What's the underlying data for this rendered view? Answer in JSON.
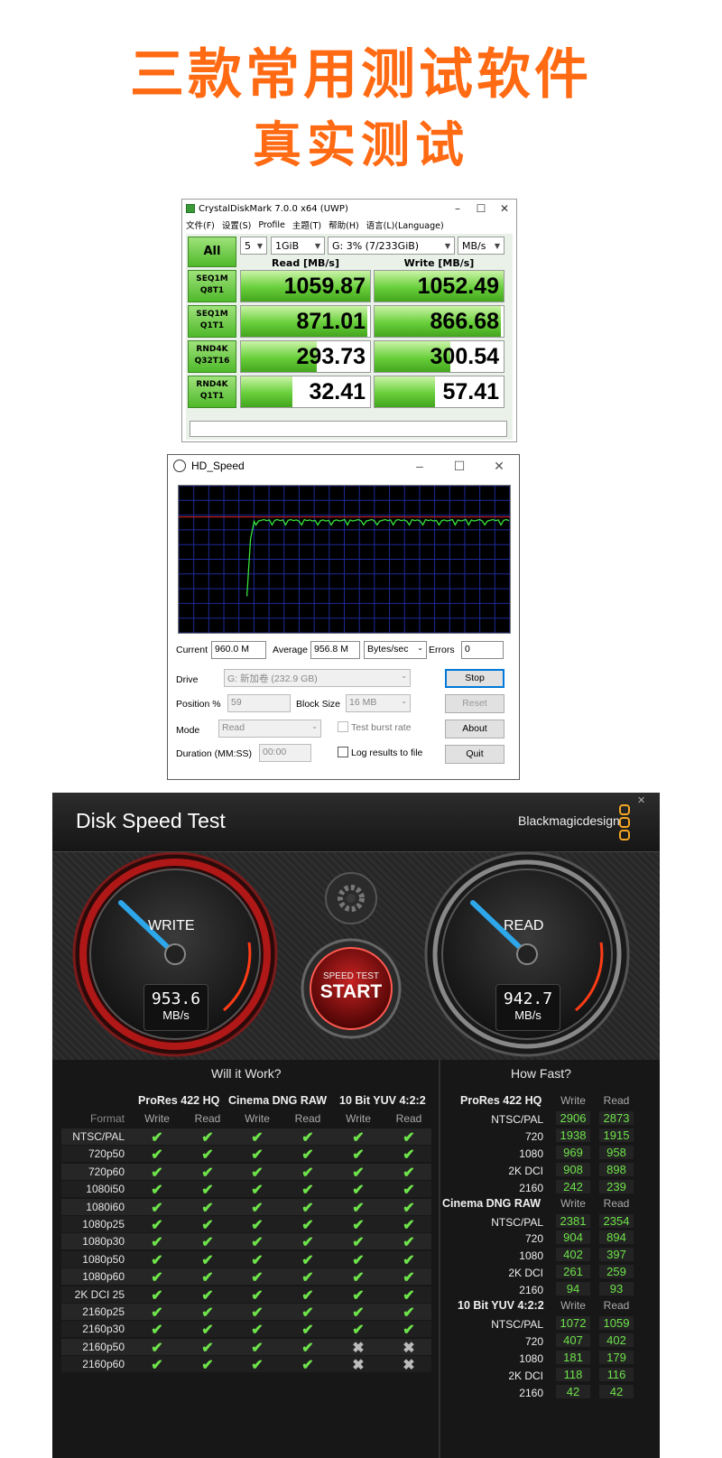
{
  "header": {
    "line1": "三款常用测试软件",
    "line2": "真实测试"
  },
  "cdm": {
    "title": "CrystalDiskMark 7.0.0 x64 (UWP)",
    "menu": [
      "文件(F)",
      "设置(S)",
      "Profile",
      "主题(T)",
      "帮助(H)",
      "语言(L)(Language)"
    ],
    "all_label": "All",
    "count": "5",
    "size": "1GiB",
    "drive": "G: 3% (7/233GiB)",
    "unit": "MB/s",
    "read_header": "Read [MB/s]",
    "write_header": "Write [MB/s]",
    "rows": [
      {
        "l1": "SEQ1M",
        "l2": "Q8T1",
        "read": "1059.87",
        "write": "1052.49",
        "read_fill": 1.0,
        "write_fill": 1.0
      },
      {
        "l1": "SEQ1M",
        "l2": "Q1T1",
        "read": "871.01",
        "write": "866.68",
        "read_fill": 0.98,
        "write_fill": 0.98
      },
      {
        "l1": "RND4K",
        "l2": "Q32T16",
        "read": "293.73",
        "write": "300.54",
        "read_fill": 0.59,
        "write_fill": 0.59
      },
      {
        "l1": "RND4K",
        "l2": "Q1T1",
        "read": "32.41",
        "write": "57.41",
        "read_fill": 0.4,
        "write_fill": 0.47
      }
    ]
  },
  "hds": {
    "title": "HD_Speed",
    "current_label": "Current",
    "current_value": "960.0 M",
    "average_label": "Average",
    "average_value": "956.8 M",
    "unit": "Bytes/sec",
    "errors_label": "Errors",
    "errors_value": "0",
    "drive_label": "Drive",
    "drive_value": "G: 新加卷 (232.9 GB)",
    "position_label": "Position %",
    "position_value": "59",
    "block_label": "Block Size",
    "block_value": "16 MB",
    "mode_label": "Mode",
    "mode_value": "Read",
    "burst_label": "Test burst rate",
    "duration_label": "Duration (MM:SS)",
    "duration_value": "00:00",
    "log_label": "Log results to file",
    "buttons": {
      "stop": "Stop",
      "reset": "Reset",
      "about": "About",
      "quit": "Quit"
    }
  },
  "bm": {
    "title": "Disk Speed Test",
    "brand": "Blackmagicdesign",
    "write_label": "WRITE",
    "write_value": "953.6",
    "write_unit": "MB/s",
    "read_label": "READ",
    "read_value": "942.7",
    "read_unit": "MB/s",
    "start_small": "SPEED TEST",
    "start_big": "START",
    "will_title": "Will it Work?",
    "how_title": "How Fast?",
    "format_label": "Format",
    "codecs": [
      "ProRes 422 HQ",
      "Cinema DNG RAW",
      "10 Bit YUV 4:2:2"
    ],
    "write_col": "Write",
    "read_col": "Read",
    "formats": [
      "NTSC/PAL",
      "720p50",
      "720p60",
      "1080i50",
      "1080i60",
      "1080p25",
      "1080p30",
      "1080p50",
      "1080p60",
      "2K DCI 25",
      "2160p25",
      "2160p30",
      "2160p50",
      "2160p60"
    ],
    "check_ok": "✔",
    "check_no": "✖",
    "how_fast": [
      {
        "name": "ProRes 422 HQ",
        "rows": [
          [
            "NTSC/PAL",
            "2906",
            "2873"
          ],
          [
            "720",
            "1938",
            "1915"
          ],
          [
            "1080",
            "969",
            "958"
          ],
          [
            "2K DCI",
            "908",
            "898"
          ],
          [
            "2160",
            "242",
            "239"
          ]
        ]
      },
      {
        "name": "Cinema DNG RAW",
        "rows": [
          [
            "NTSC/PAL",
            "2381",
            "2354"
          ],
          [
            "720",
            "904",
            "894"
          ],
          [
            "1080",
            "402",
            "397"
          ],
          [
            "2K DCI",
            "261",
            "259"
          ],
          [
            "2160",
            "94",
            "93"
          ]
        ]
      },
      {
        "name": "10 Bit YUV 4:2:2",
        "rows": [
          [
            "NTSC/PAL",
            "1072",
            "1059"
          ],
          [
            "720",
            "407",
            "402"
          ],
          [
            "1080",
            "181",
            "179"
          ],
          [
            "2K DCI",
            "118",
            "116"
          ],
          [
            "2160",
            "42",
            "42"
          ]
        ]
      }
    ]
  }
}
